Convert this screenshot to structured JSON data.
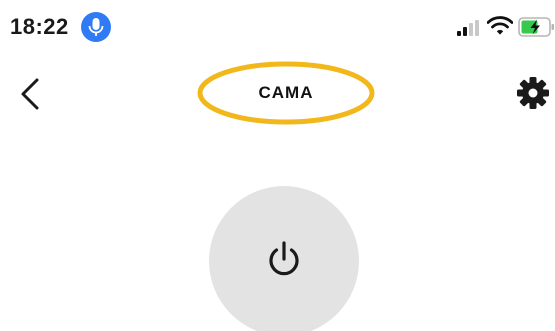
{
  "status_bar": {
    "time": "18:22",
    "icons": [
      "microphone-icon",
      "cellular-signal-icon",
      "wifi-icon",
      "battery-charging-icon"
    ]
  },
  "header": {
    "title": "CAMA",
    "back_icon": "chevron-left-icon",
    "settings_icon": "gear-icon"
  },
  "main": {
    "power_icon": "power-icon"
  },
  "colors": {
    "highlight": "#F2B81B",
    "mic_badge": "#2F7BF5",
    "battery_fill": "#37C84E",
    "power_button_bg": "#E3E3E3",
    "icon": "#1A1A1A"
  }
}
